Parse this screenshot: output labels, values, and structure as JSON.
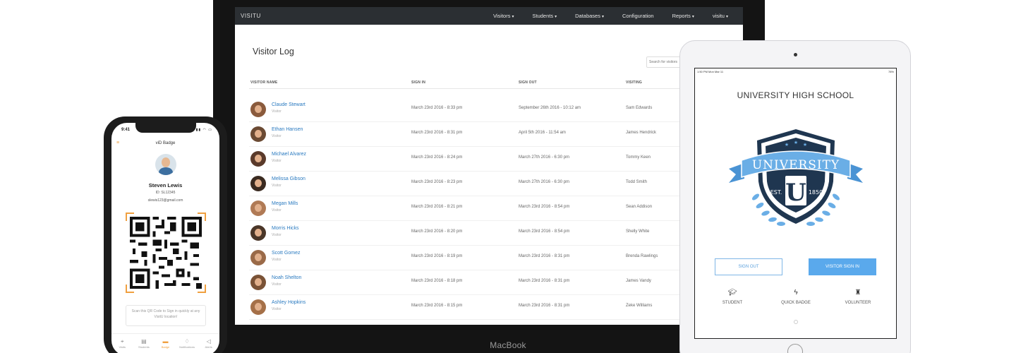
{
  "laptop": {
    "brand": "VISITU",
    "device_label": "MacBook",
    "nav": [
      {
        "label": "Visitors",
        "caret": "▾"
      },
      {
        "label": "Students",
        "caret": "▾"
      },
      {
        "label": "Databases",
        "caret": "▾"
      },
      {
        "label": "Configuration",
        "caret": ""
      },
      {
        "label": "Reports",
        "caret": "▾"
      },
      {
        "label": "visitu",
        "caret": "▾"
      }
    ],
    "page_title": "Visitor Log",
    "search_placeholder": "Search for visitors",
    "columns": [
      "VISITOR NAME",
      "SIGN IN",
      "SIGN OUT",
      "VISITING"
    ],
    "rows": [
      {
        "name": "Claude Stewart",
        "sub": "Visitor",
        "sign_in": "March 23rd 2016 - 8:33 pm",
        "sign_out": "September 26th 2016 - 10:12 am",
        "visiting": "Sam Edwards"
      },
      {
        "name": "Ethan Hansen",
        "sub": "Visitor",
        "sign_in": "March 23rd 2016 - 8:31 pm",
        "sign_out": "April 5th 2016 - 11:54 am",
        "visiting": "James Hendrick"
      },
      {
        "name": "Michael Alvarez",
        "sub": "Visitor",
        "sign_in": "March 23rd 2016 - 8:24 pm",
        "sign_out": "March 27th 2016 - 6:30 pm",
        "visiting": "Tommy Keen"
      },
      {
        "name": "Melissa Gibson",
        "sub": "Visitor",
        "sign_in": "March 23rd 2016 - 8:23 pm",
        "sign_out": "March 27th 2016 - 6:30 pm",
        "visiting": "Todd Smith"
      },
      {
        "name": "Megan Mills",
        "sub": "Visitor",
        "sign_in": "March 23rd 2016 - 8:21 pm",
        "sign_out": "March 23rd 2016 - 8:54 pm",
        "visiting": "Sean Addison"
      },
      {
        "name": "Morris Hicks",
        "sub": "Visitor",
        "sign_in": "March 23rd 2016 - 8:20 pm",
        "sign_out": "March 23rd 2016 - 8:54 pm",
        "visiting": "Shelly White"
      },
      {
        "name": "Scott Gomez",
        "sub": "Visitor",
        "sign_in": "March 23rd 2016 - 8:19 pm",
        "sign_out": "March 23rd 2016 - 8:31 pm",
        "visiting": "Brenda Rawlings"
      },
      {
        "name": "Noah Shelton",
        "sub": "Visitor",
        "sign_in": "March 23rd 2016 - 8:18 pm",
        "sign_out": "March 23rd 2016 - 8:31 pm",
        "visiting": "James Vandy"
      },
      {
        "name": "Ashley Hopkins",
        "sub": "Visitor",
        "sign_in": "March 23rd 2016 - 8:15 pm",
        "sign_out": "March 23rd 2016 - 8:31 pm",
        "visiting": "Zeke Williams"
      }
    ]
  },
  "phone": {
    "time": "9:41",
    "status_icons": "signal wifi battery",
    "title": "viD Badge",
    "user_name": "Steven Lewis",
    "user_id": "ID: SL12345",
    "user_email": "slewis123@gmail.com",
    "qr_hint": "Scan this QR Code to Sign in quickly at any VisitU location!",
    "tabs": [
      {
        "label": "Visits",
        "icon": "pin-icon",
        "active": false
      },
      {
        "label": "Students",
        "icon": "card-icon",
        "active": false
      },
      {
        "label": "Badge",
        "icon": "badge-icon",
        "active": true
      },
      {
        "label": "Notifications",
        "icon": "bell-icon",
        "active": false
      },
      {
        "label": "Alerts",
        "icon": "megaphone-icon",
        "active": false
      }
    ],
    "accent_color": "#f0a040"
  },
  "tablet": {
    "status_left": "1:50 PM  Mon Mar 11",
    "status_right": "78%",
    "school_name": "UNIVERSITY HIGH SCHOOL",
    "crest": {
      "banner": "UNIVERSITY",
      "est": "EST.",
      "year": "1850",
      "letter": "U"
    },
    "sign_out_label": "SIGN OUT",
    "sign_in_label": "VISITOR SIGN IN",
    "options": [
      {
        "label": "STUDENT",
        "icon": "graduation-cap-icon"
      },
      {
        "label": "QUICK BADGE",
        "icon": "lightning-icon"
      },
      {
        "label": "VOLUNTEER",
        "icon": "trophy-icon"
      }
    ],
    "accent_color": "#5aa9ec"
  }
}
